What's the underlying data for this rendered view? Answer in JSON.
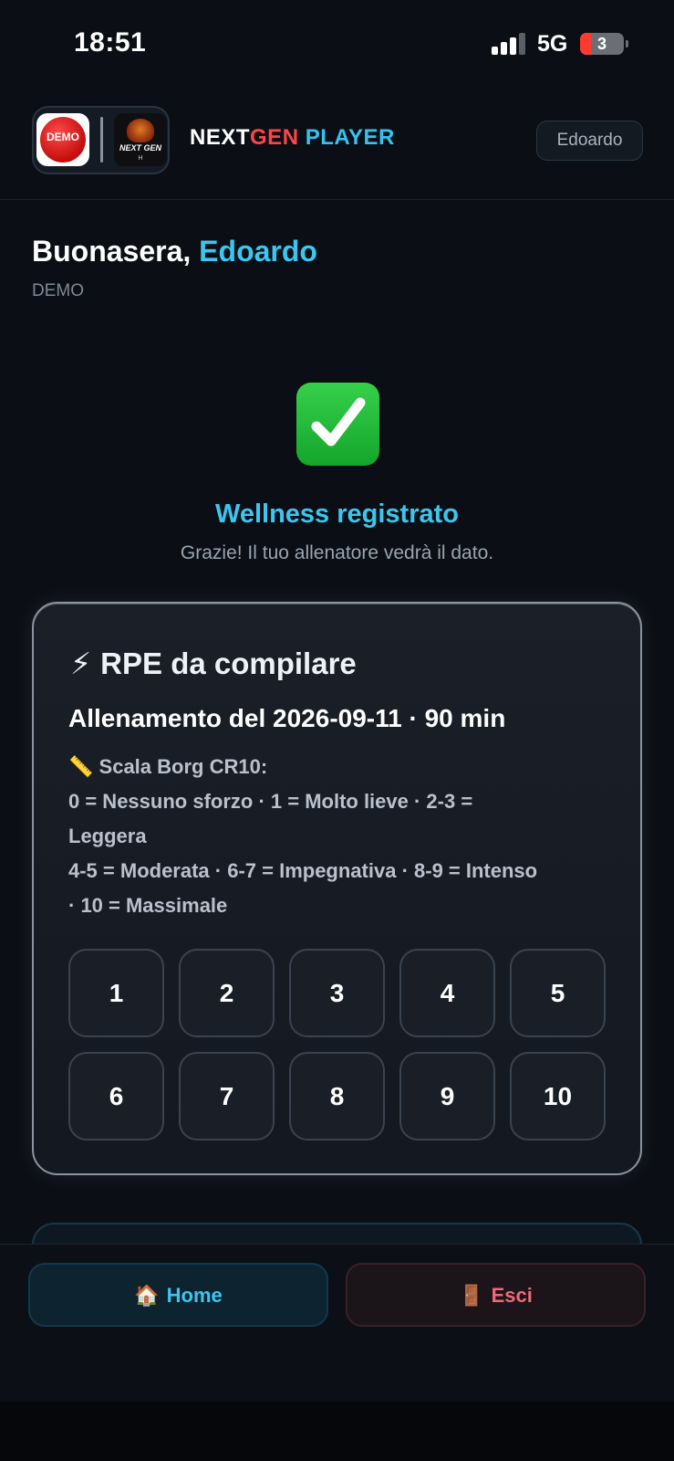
{
  "status_bar": {
    "time": "18:51",
    "network": "5G",
    "battery": "3",
    "battery_level": 0.03
  },
  "header": {
    "demo_logo_text": "DEMO",
    "club_logo_text": "NEXT GEN",
    "club_logo_sub": "H",
    "brand_part1": "NEXT",
    "brand_part2": "GEN",
    "brand_part3": "PLAYER",
    "user_chip": "Edoardo",
    "colors": {
      "accent": "#3bc6ef",
      "brand_red": "#ff4545"
    }
  },
  "greeting": {
    "salutation": "Buonasera,",
    "name": "Edoardo",
    "team": "DEMO"
  },
  "success": {
    "icon": "check-mark-icon",
    "title": "Wellness registrato",
    "subtitle": "Grazie! Il tuo allenatore vedrà il dato."
  },
  "rpe_card": {
    "icon": "⚡",
    "title": "RPE da compilare",
    "session": "Allenamento del 2026-09-11 · 90 min",
    "scale_icon": "📏",
    "scale_title": "Scala Borg CR10:",
    "scale_line1": "0 = Nessuno sforzo · 1 = Molto lieve · 2-3 = Leggera",
    "scale_line2": "4-5 = Moderata · 6-7 = Impegnativa · 8-9 = Intenso · 10 = Massimale",
    "buttons": [
      "1",
      "2",
      "3",
      "4",
      "5",
      "6",
      "7",
      "8",
      "9",
      "10"
    ]
  },
  "bottom_nav": {
    "home_icon": "🏠",
    "home_label": "Home",
    "exit_icon": "🚪",
    "exit_label": "Esci"
  }
}
